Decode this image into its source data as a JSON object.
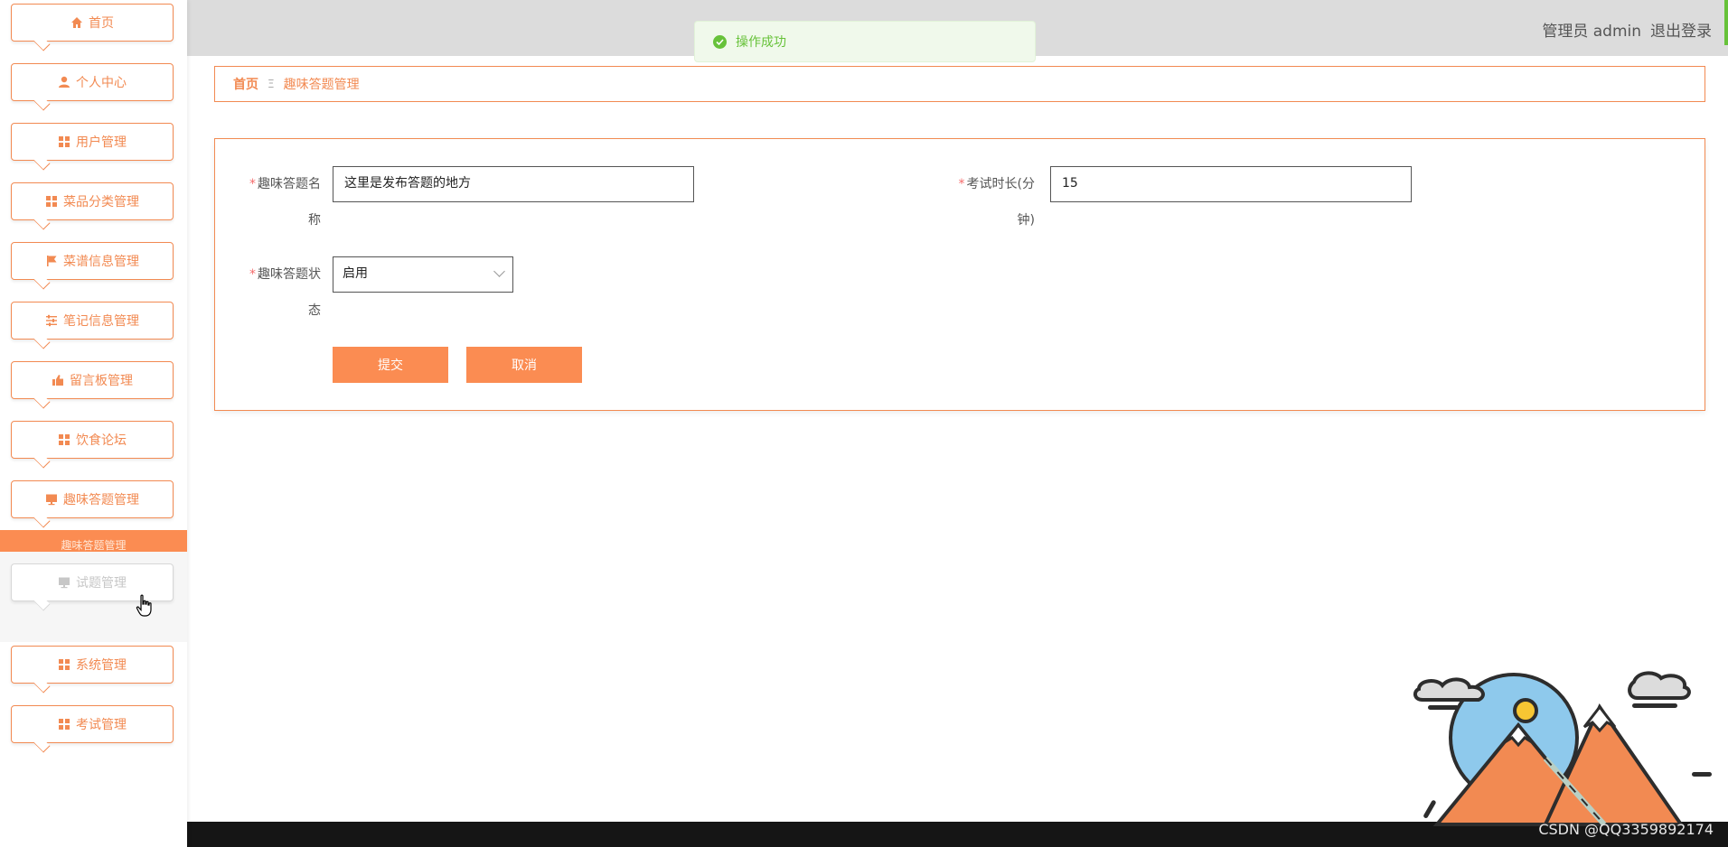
{
  "sidebar": {
    "items": [
      {
        "label": "首页",
        "icon": "home-icon"
      },
      {
        "label": "个人中心",
        "icon": "user-icon"
      },
      {
        "label": "用户管理",
        "icon": "grid-icon"
      },
      {
        "label": "菜品分类管理",
        "icon": "grid-icon"
      },
      {
        "label": "菜谱信息管理",
        "icon": "flag-icon"
      },
      {
        "label": "笔记信息管理",
        "icon": "sliders-icon"
      },
      {
        "label": "留言板管理",
        "icon": "thumb-icon"
      },
      {
        "label": "饮食论坛",
        "icon": "grid-icon"
      },
      {
        "label": "趣味答题管理",
        "icon": "monitor-icon"
      },
      {
        "label": "试题管理",
        "icon": "monitor-icon"
      },
      {
        "label": "系统管理",
        "icon": "grid-icon"
      },
      {
        "label": "考试管理",
        "icon": "grid-icon"
      }
    ],
    "active_label": "趣味答题管理"
  },
  "header": {
    "role": "管理员 admin",
    "logout": "退出登录"
  },
  "toast": {
    "message": "操作成功"
  },
  "breadcrumb": {
    "home": "首页",
    "separator": "Ξ",
    "current": "趣味答题管理"
  },
  "form": {
    "name_label_line1": "趣味答题名",
    "name_label_line2": "称",
    "name_value": "这里是发布答题的地方",
    "duration_label_line1": "考试时长(分",
    "duration_label_line2": "钟)",
    "duration_value": "15",
    "status_label_line1": "趣味答题状",
    "status_label_line2": "态",
    "status_value": "启用",
    "required_mark": "*",
    "submit": "提交",
    "cancel": "取消"
  },
  "watermark": "CSDN @QQ3359892174",
  "colors": {
    "accent": "#fb8c52",
    "border": "#f28a52",
    "success": "#67c23a"
  }
}
